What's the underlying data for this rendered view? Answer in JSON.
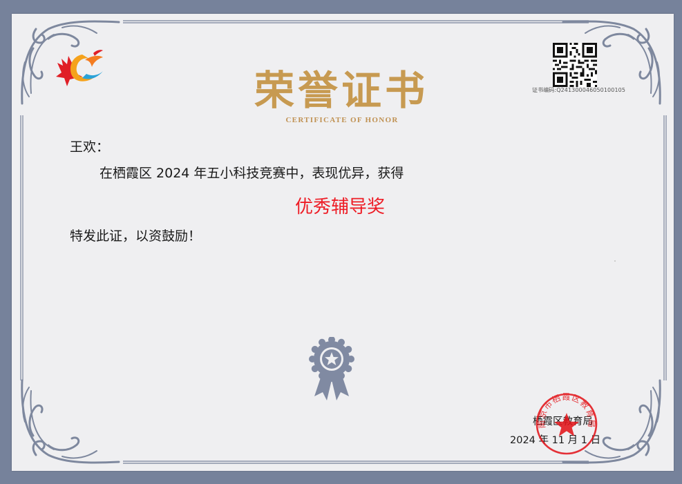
{
  "certificate": {
    "title": "荣誉证书",
    "subtitle": "CERTIFICATE OF HONOR",
    "certificate_number": "证书编码:Q2413000460501001​05",
    "recipient": "王欢：",
    "body_text": "在栖霞区 2024 年五小科技竞赛中，表现优异，获得",
    "award_name": "优秀辅导奖",
    "closing_text": "特发此证，以资鼓励！",
    "issuer": "栖霞区教育局",
    "issue_date": "2024 年 11 月 1 日",
    "seal_text": "南京市栖霞区教育局"
  },
  "colors": {
    "page_background": "#76829b",
    "paper": "#efeff1",
    "frame": "#7e889e",
    "title_gold": "#c79a51",
    "award_red": "#ee1c25",
    "seal_red": "#e3161c"
  },
  "icons": {
    "logo": "maple-leaf-flame-logo",
    "qr": "qr-code",
    "medal": "award-rosette-star-icon",
    "seal": "official-red-seal"
  }
}
